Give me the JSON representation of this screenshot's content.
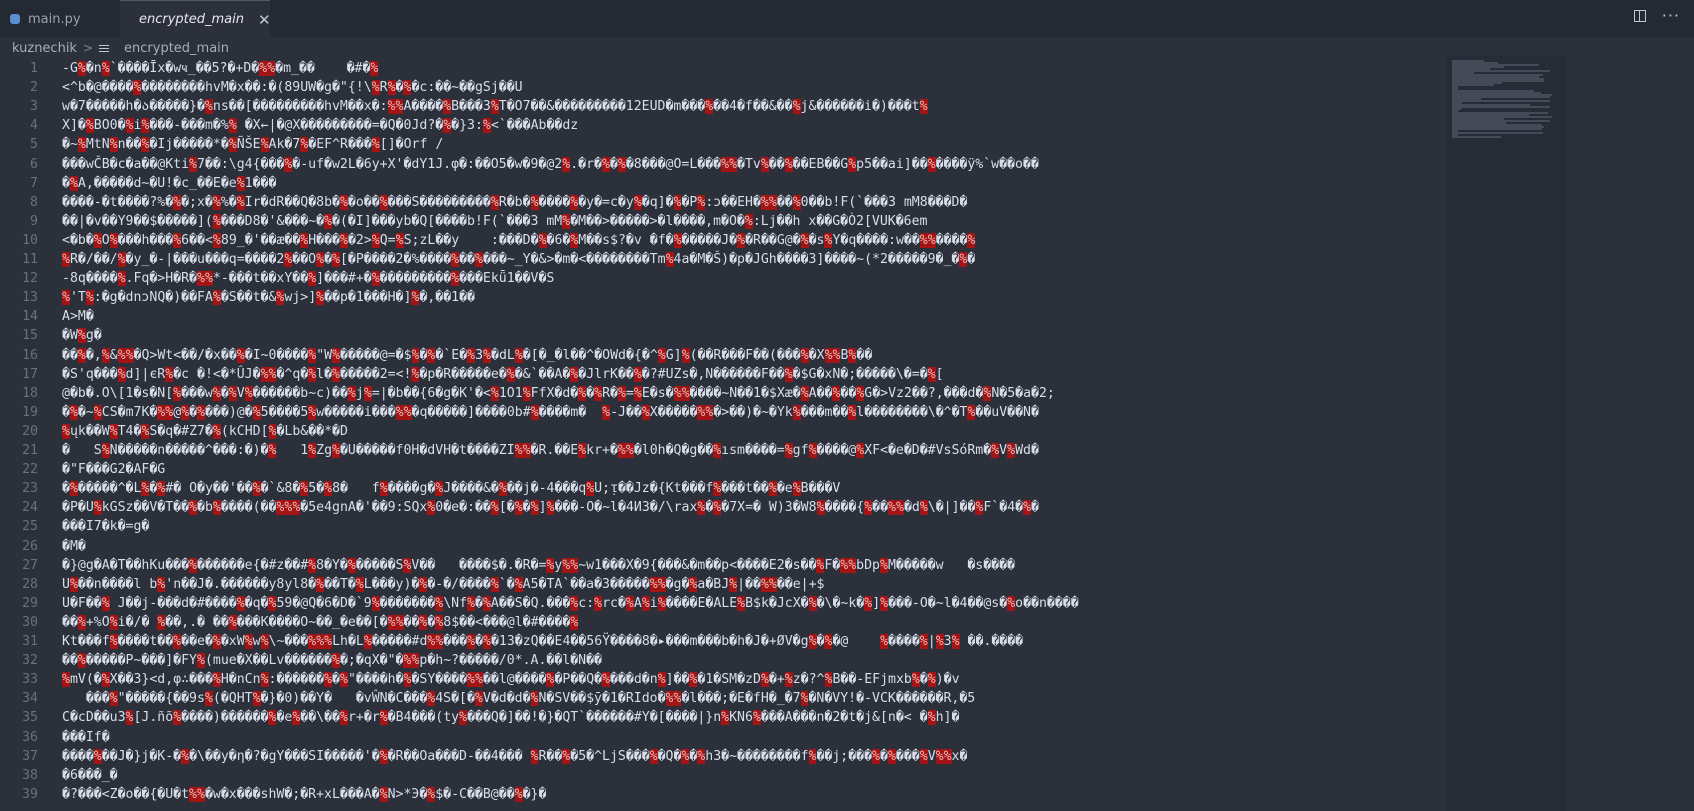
{
  "tabs": [
    {
      "label": "main.py",
      "icon": "python-file-icon",
      "active": false
    },
    {
      "label": "encrypted_main",
      "icon": "text-file-icon",
      "active": true
    }
  ],
  "toolbar": {
    "split_icon": "split-editor-icon",
    "more_icon": "more-actions-icon"
  },
  "breadcrumb": {
    "folder": "kuznechik",
    "separator": ">",
    "file": "encrypted_main"
  },
  "editor": {
    "lines": [
      {
        "n": "1",
        "text": "-G■�n■`����Īx�wҹ_��5?�+D�■■�m_��    �#�■"
      },
      {
        "n": "2",
        "text": "<^b�@����■��������hvM�x��:�(89UW�g�\"{!\\■R■�■�c:��~��gSj��U"
      },
      {
        "n": "3",
        "text": "w�7�����h�ა�����}�■ns��[���������hvM��x�:■■A����■B���3■T�O7��&���������12EUD�m���■��4�f��&��■j&������i�)���t■"
      },
      {
        "n": "4",
        "text": "X]�■BO0�■i■���-���m�%■ �X←|�@X���������=�Q�0Jd?�■�}3:■<`���Ab��dz"
      },
      {
        "n": "5",
        "text": "�~■MtN■n��■�Ij�����*�■ÑŠE■Ak�7■�EF^R���■[]�Orf /"
      },
      {
        "n": "6",
        "text": "���wČB�c�a��@Kti■7��:\\g4{���■�-uf�w2L�6y+X'�dY1J.φ�:��O5�w�9�@2■.�r�■�■�8���@O=L���■■�Tv■��■��EB��G■p5��ai]��■����ÿ%`w��o��"
      },
      {
        "n": "7",
        "text": "�■A,�����d~�U!�c_��E�e■1���"
      },
      {
        "n": "8",
        "text": "����-�t����?%�■�;x�■%�■Ir�dR��Q�8b�■�o��■���S���������■R�b�■����■�y�=c�y■�q]�■�P■:ɔ��EH�■■��■0��b!F(`���3 mM8���D�"
      },
      {
        "n": "9",
        "text": "��|�v��Y9��$�����](■���D8�'&���~�■�(�I]���yb�Q[����b!F(`���3 mM■�M��>�����>�l����,m�O�■:Lj��h x��G�Ò2[VUK�6em"
      },
      {
        "n": "10",
        "text": "<�b�■O■���h���■6��<■89_�'��æ��■H���■�2>■Q=■S;zL��y    :���D�■�6�■M��s$?�v �f�■�����J�■�R��G@�■�s■Y�q����:w��■■����■"
      },
      {
        "n": "11",
        "text": "■R�/��/■�y_�-|���u���q=����2■��O■�■[�P����2�%����■��■���~_Y�&>�m�<��������Tm■4a�M�Š)�p�JGһ����3]����~(*2�����9�_�■�"
      },
      {
        "n": "12",
        "text": "-8q����■.Fq�>H�R�■■*-���t��xY��■]���#+�■���������■���Ekǖ1��V�S"
      },
      {
        "n": "13",
        "text": "■'T■:�g�dnɔNQ�)��FA■�S��t�&■wj>]■��p�1���H�]■�,��1��"
      },
      {
        "n": "14",
        "text": "A>M�"
      },
      {
        "n": "15",
        "text": "�W■g�"
      },
      {
        "n": "16",
        "text": "��■�,■&■■�Q>Wt<��/�x��■�I~0����■\"W■�����@=�$■�■�`E�■3■�dL■�[�_�l��^�OWd�{�^■G]■(��R���F��(���■�X■■B■��"
      },
      {
        "n": "17",
        "text": "�S'q���■d]|єR■�c �!<�*ÛJ�■■�^q�■l�■�����2=<!■�p�R�����e�■�&`��A�■�JlrK��■�?#UZs�,N������F��■�$G�xN�;�����\\�=�■["
      },
      {
        "n": "18",
        "text": "@�b�.O\\[1�s�N[■���w■�■V■������b~c)��■j■=|�b��{6�g�K'�<■1O1■FfX�d�■�■R�■=■E�s�■■����~N��1�$Xæ�■A��■��■G�>Vz2��?,���d�■N�5�a�2;"
      },
      {
        "n": "19",
        "text": "�■�~■CS�m7K�■■@■�■���)@�■5����5■w�����i���■■�q�����]����0b#■����m�  ■-J��■X�����■■�>��)�~�Yk■���m��■l��������\\�^�T■��uV��N�"
      },
      {
        "n": "20",
        "text": "■ųk��W■T4�■S�q�#Z7�■(kCHD[■�Lb&��*�D"
      },
      {
        "n": "21",
        "text": "�   S■N�����n�����^���:�)�■   1■Zg■�U�����f0H�dVH�t����ZI■■�R.��E■kr+�■■�l0h�Q�g��■ısm����=■gf■����@■XF<�e�D�#VsSóRm�■V■Wd�"
      },
      {
        "n": "22",
        "text": "�\"F���G2�AF�G"
      },
      {
        "n": "23",
        "text": "�■�����^�L■�■#� O�y��'��■�`&8�■5�■8�   f■����g�■J����&�■��j�-4���q■U;ᴉ��Jz�{Kt���f■���t��■�e■B���V"
      },
      {
        "n": "24",
        "text": "�P�U■kGSz��V�T��■�b■����(��■■■�5e4gnA�'��9:SQx■0�e�:��■[�■�■]■���-O�~l�4И3�/\\rax■�■�7X=� W)3�W8■����{■��■■�d■\\�|]��■F`�4�■�"
      },
      {
        "n": "25",
        "text": "���I7�k�=g�"
      },
      {
        "n": "26",
        "text": "�M�"
      },
      {
        "n": "27",
        "text": "�}@g�A�T��hKu���■������e{�#z��#■8�Y�■�����S■V��   ����$�.�R�=■y■■~w1���X�9{���&�m��p<����E2�s��■F�■■bDp■M�����w   �s����"
      },
      {
        "n": "28",
        "text": "U■��n����l b■'n��J�.������y8yl8�■��T�■L���y)�■�-�/����■`�■A5�TA`��a�3�����■■�g�■a�BJ■|��■■��e|+$"
      },
      {
        "n": "29",
        "text": "U�F��■ J��j-���d�#����■�q�■59�@Q�6�D�`9■�������■\\Nf■�■A��S�Q.���■c:■rc�■A■i■����E�ALE■B$k�JcX�■�\\�~k�■]■���-O�~l�4��@s�■o��n����"
      },
      {
        "n": "30",
        "text": "��■+%O■i�/� ■��,.� ��■���K����O~��_�e��[�■■��■�■8$��<���@l�#����■"
      },
      {
        "n": "31",
        "text": "Kt���f■����t��■��e�■�xW■w■\\~���■■■Lh�L■�����#d■■���■�■�13�zQ��E4��56Ÿ����8�▸���m���b�h�J�+ØV�g■�■�@    ■����■|■3■ ��.����"
      },
      {
        "n": "32",
        "text": "��■�����P~���]�FY■(mue�X��Lv������■�;�qX�\"�■■p�h~?�����/0*.A.��l�N��"
      },
      {
        "n": "33",
        "text": "■mV(�■X��3}<d,φ∴���■H�nCn■:������■�■\"����h�■�SY����■■��l@����■�P��Q�■���d�n■]��■�1�SM�zD■�+■z�?^■B��-EFjmxb■�■)�v"
      },
      {
        "n": "34",
        "text": "   ���■\"�����{��9s■(�QHT■�}�0)��Y�   �vŴN�C���■4S�[�■V�d�d�■N�SV��$ӯ�1�RIdо�■■�l���;�E�fH�_�7■�N�VY!�-VCK������R,�5"
      },
      {
        "n": "35",
        "text": "C�cD��u3■[J.ñõ■����)������■�e■��\\��■r+�r■�B4���(ty■���Q�]��!�}�QT`������#Y�[����|}n■KN6■���A���n�2�t�j&[n�< �■h]�"
      },
      {
        "n": "36",
        "text": "���If�"
      },
      {
        "n": "37",
        "text": "����■��J�}j�K-�■�\\��y�η�?�gY���SI�����'�■�R��Oa���D-��4��� ■R��■�5�^LjS���■�Q�■�■h3�~��������f■��j;���■�■���■V■■x�"
      },
      {
        "n": "38",
        "text": "�6���_�"
      },
      {
        "n": "39",
        "text": "�?���<Z�o��{�U�t■■�w�x���shW�;�R+xL���A�■N>*Э�■$�-C��B@��■�}�"
      }
    ]
  }
}
